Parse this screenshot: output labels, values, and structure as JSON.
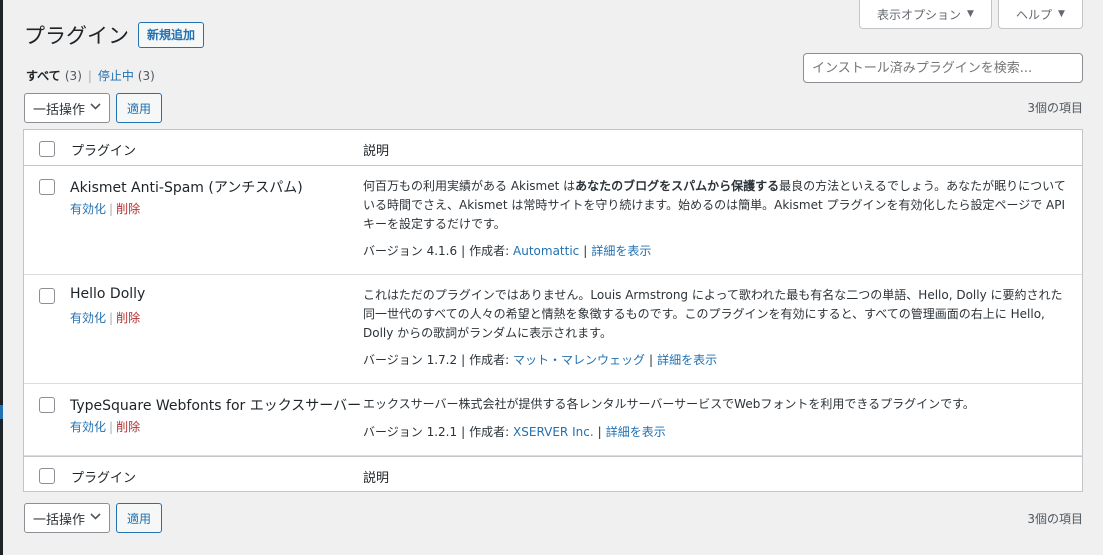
{
  "header": {
    "screen_options_label": "表示オプション",
    "help_label": "ヘルプ",
    "title": "プラグイン",
    "add_new_label": "新規追加"
  },
  "filters": {
    "all_label": "すべて",
    "all_count": "(3)",
    "inactive_label": "停止中",
    "inactive_count": "(3)",
    "separator": "|"
  },
  "search": {
    "placeholder": "インストール済みプラグインを検索..."
  },
  "bulk_actions": {
    "select_label": "一括操作",
    "apply_label": "適用",
    "items_count": "3個の項目"
  },
  "table": {
    "col_plugin": "プラグイン",
    "col_description": "説明",
    "rows": [
      {
        "name": "Akismet Anti-Spam (アンチスパム)",
        "activate": "有効化",
        "delete": "削除",
        "desc_before": "何百万もの利用実績がある Akismet は",
        "desc_bold": "あなたのブログをスパムから保護する",
        "desc_after": "最良の方法といえるでしょう。あなたが眠りについている時間でさえ、Akismet は常時サイトを守り続けます。始めるのは簡単。Akismet プラグインを有効化したら設定ページで API キーを設定するだけです。",
        "version": "バージョン 4.1.6",
        "by_label": "作成者:",
        "author": "Automattic",
        "details": "詳細を表示"
      },
      {
        "name": "Hello Dolly",
        "activate": "有効化",
        "delete": "削除",
        "desc_before": "これはただのプラグインではありません。Louis Armstrong によって歌われた最も有名な二つの単語、Hello, Dolly に要約された同一世代のすべての人々の希望と情熱を象徴するものです。このプラグインを有効にすると、すべての管理画面の右上に Hello, Dolly からの歌詞がランダムに表示されます。",
        "desc_bold": "",
        "desc_after": "",
        "version": "バージョン 1.7.2",
        "by_label": "作成者:",
        "author": "マット・マレンウェッグ",
        "details": "詳細を表示"
      },
      {
        "name": "TypeSquare Webfonts for エックスサーバー",
        "activate": "有効化",
        "delete": "削除",
        "desc_before": "エックスサーバー株式会社が提供する各レンタルサーバーサービスでWebフォントを利用できるプラグインです。",
        "desc_bold": "",
        "desc_after": "",
        "version": "バージョン 1.2.1",
        "by_label": "作成者:",
        "author": "XSERVER Inc.",
        "details": "詳細を表示"
      }
    ]
  }
}
